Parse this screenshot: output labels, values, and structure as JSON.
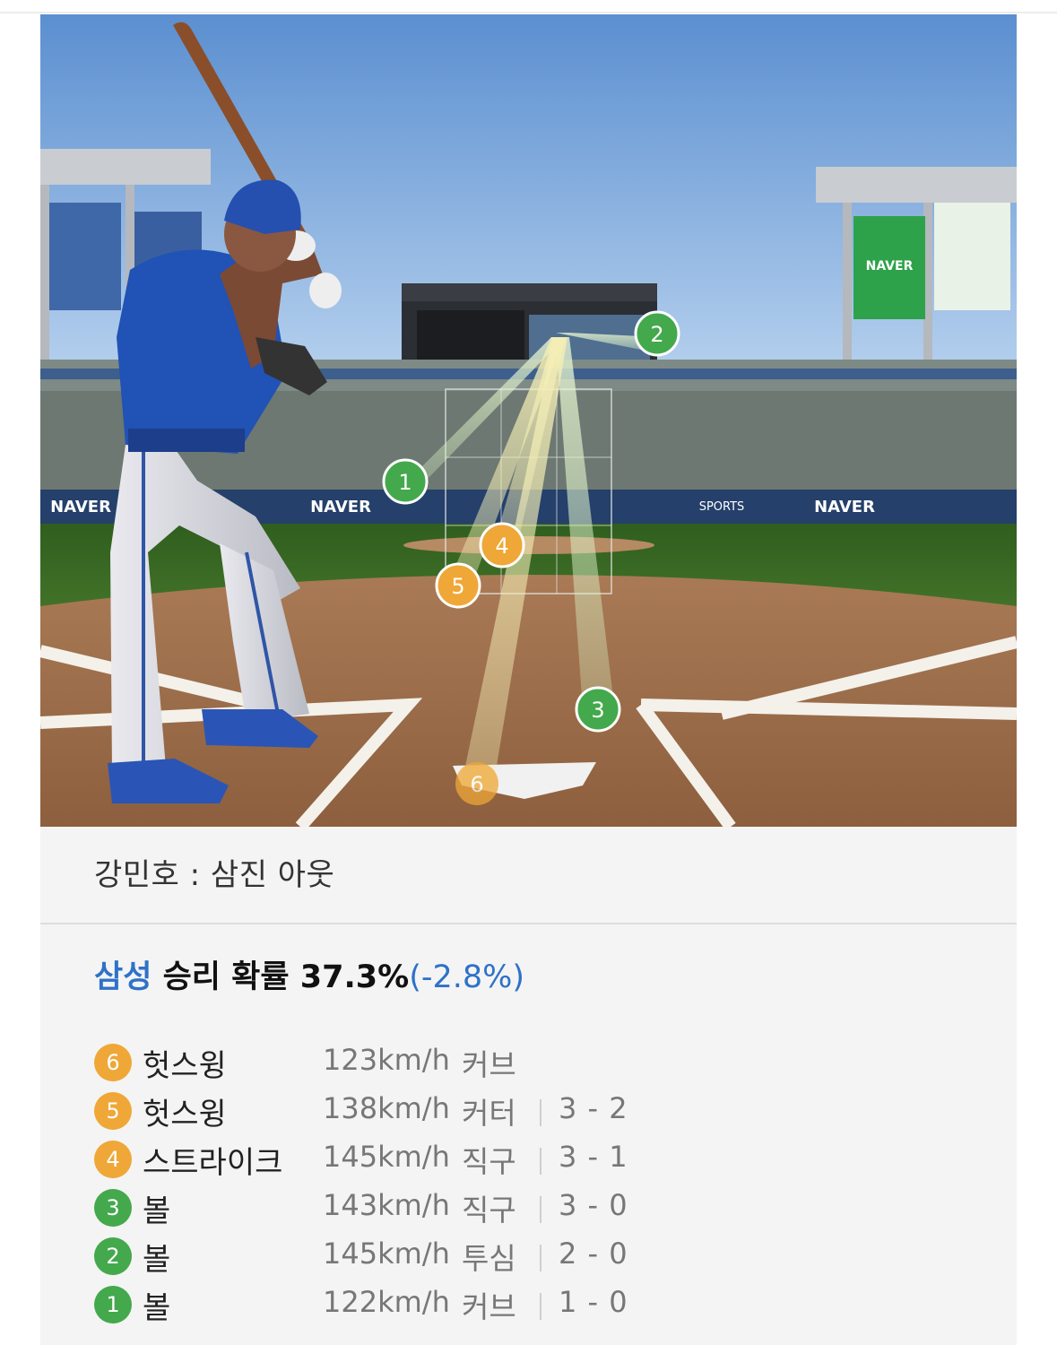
{
  "at_bat_result": "강민호 : 삼진 아웃",
  "win_probability": {
    "team": "삼성",
    "text": "승리 확률 37.3%",
    "delta": "(-2.8%)"
  },
  "scene": {
    "brand": "NAVER",
    "sports_label": "SPORTS",
    "markers": [
      {
        "num": "1",
        "color": "green"
      },
      {
        "num": "2",
        "color": "green"
      },
      {
        "num": "3",
        "color": "green"
      },
      {
        "num": "4",
        "color": "orange"
      },
      {
        "num": "5",
        "color": "orange"
      },
      {
        "num": "6",
        "color": "orange"
      }
    ]
  },
  "pitches": [
    {
      "num": "6",
      "color": "orange",
      "result": "헛스윙",
      "speed": "123km/h",
      "type": "커브",
      "count": ""
    },
    {
      "num": "5",
      "color": "orange",
      "result": "헛스윙",
      "speed": "138km/h",
      "type": "커터",
      "count": "3 - 2"
    },
    {
      "num": "4",
      "color": "orange",
      "result": "스트라이크",
      "speed": "145km/h",
      "type": "직구",
      "count": "3 - 1"
    },
    {
      "num": "3",
      "color": "green",
      "result": "볼",
      "speed": "143km/h",
      "type": "직구",
      "count": "3 - 0"
    },
    {
      "num": "2",
      "color": "green",
      "result": "볼",
      "speed": "145km/h",
      "type": "투심",
      "count": "2 - 0"
    },
    {
      "num": "1",
      "color": "green",
      "result": "볼",
      "speed": "122km/h",
      "type": "커브",
      "count": "1 - 0"
    }
  ],
  "colors": {
    "green": "#43a94c",
    "orange": "#efa737",
    "accent_blue": "#2e72c7"
  }
}
